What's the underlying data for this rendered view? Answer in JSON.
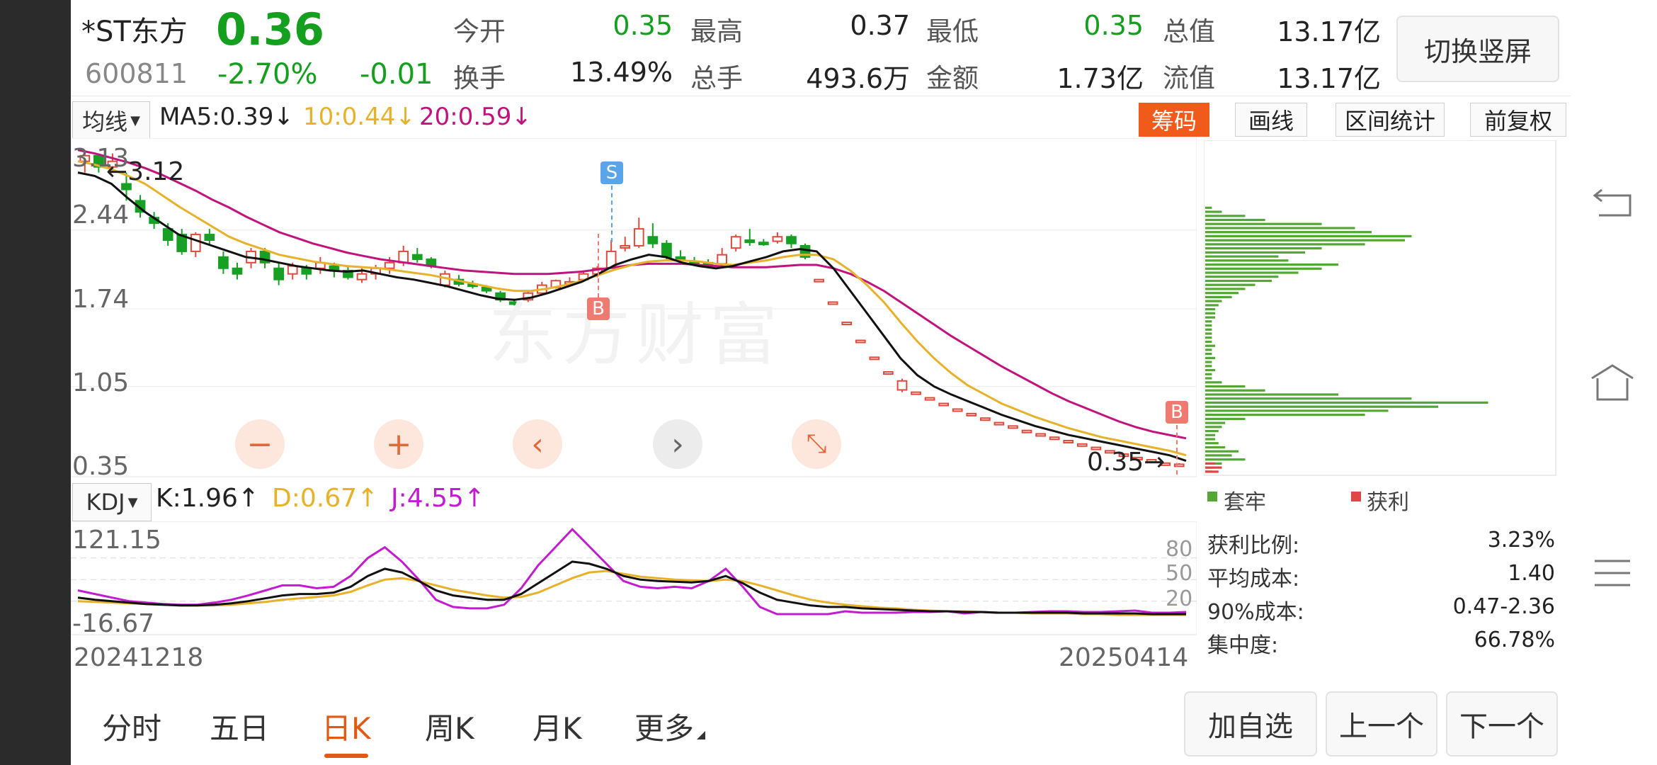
{
  "header": {
    "name": "*ST东方",
    "price": "0.36",
    "code": "600811",
    "pct": "-2.70%",
    "change": "-0.01",
    "fields": [
      {
        "label": "今开",
        "value": "0.35",
        "color": "green"
      },
      {
        "label": "最高",
        "value": "0.37",
        "color": "black"
      },
      {
        "label": "最低",
        "value": "0.35",
        "color": "green"
      },
      {
        "label": "总值",
        "value": "13.17亿",
        "color": "black"
      },
      {
        "label": "换手",
        "value": "13.49%",
        "color": "black"
      },
      {
        "label": "总手",
        "value": "493.6万",
        "color": "black"
      },
      {
        "label": "金额",
        "value": "1.73亿",
        "color": "black"
      },
      {
        "label": "流值",
        "value": "13.17亿",
        "color": "black"
      }
    ],
    "switch_label": "切换竖屏"
  },
  "ma": {
    "selector": "均线",
    "ma5": "MA5:0.39↓",
    "ma10": "10:0.44↓",
    "ma20": "20:0.59↓"
  },
  "tools": {
    "chips": "筹码",
    "draw": "画线",
    "range": "区间统计",
    "adjust": "前复权"
  },
  "price_axis": [
    "3.13",
    "2.44",
    "1.74",
    "1.05",
    "0.35"
  ],
  "annotations": {
    "high": "←3.12",
    "low": "0.35→",
    "sell": "S",
    "buy": "B"
  },
  "watermark": "东方财富",
  "kdj": {
    "selector": "KDJ",
    "k": "K:1.96↑",
    "d": "D:0.67↑",
    "j": "J:4.55↑",
    "axis_top": "121.15",
    "axis_bottom": "-16.67",
    "levels": [
      "80",
      "50",
      "20"
    ]
  },
  "dates": {
    "start": "20241218",
    "end": "20250414"
  },
  "chips": {
    "legend_trap": "套牢",
    "legend_profit": "获利",
    "stats": [
      {
        "label": "获利比例:",
        "value": "3.23%"
      },
      {
        "label": "平均成本:",
        "value": "1.40"
      },
      {
        "label": "90%成本:",
        "value": "0.47-2.36"
      },
      {
        "label": "集中度:",
        "value": "66.78%"
      }
    ]
  },
  "tabs": [
    {
      "label": "分时",
      "active": false
    },
    {
      "label": "五日",
      "active": false
    },
    {
      "label": "日K",
      "active": true
    },
    {
      "label": "周K",
      "active": false
    },
    {
      "label": "月K",
      "active": false
    },
    {
      "label": "更多",
      "active": false
    }
  ],
  "buttons": {
    "add": "加自选",
    "prev": "上一个",
    "next": "下一个"
  },
  "chart_data": {
    "type": "line",
    "ma5": [
      2.95,
      2.92,
      2.85,
      2.72,
      2.6,
      2.5,
      2.4,
      2.35,
      2.3,
      2.25,
      2.2,
      2.18,
      2.15,
      2.12,
      2.1,
      2.08,
      2.07,
      2.08,
      2.05,
      2.02,
      2.0,
      1.97,
      1.94,
      1.9,
      1.86,
      1.83,
      1.82,
      1.84,
      1.88,
      1.93,
      1.98,
      2.05,
      2.13,
      2.18,
      2.22,
      2.2,
      2.15,
      2.12,
      2.1,
      2.12,
      2.16,
      2.2,
      2.25,
      2.27,
      2.25,
      2.1,
      1.9,
      1.7,
      1.5,
      1.3,
      1.15,
      1.05,
      0.98,
      0.92,
      0.86,
      0.8,
      0.75,
      0.7,
      0.66,
      0.62,
      0.59,
      0.56,
      0.53,
      0.5,
      0.47,
      0.44,
      0.39
    ],
    "ma10": [
      3.05,
      3.02,
      2.98,
      2.92,
      2.85,
      2.75,
      2.65,
      2.56,
      2.47,
      2.38,
      2.32,
      2.27,
      2.22,
      2.19,
      2.16,
      2.14,
      2.12,
      2.11,
      2.1,
      2.08,
      2.06,
      2.04,
      2.01,
      1.98,
      1.95,
      1.92,
      1.9,
      1.9,
      1.92,
      1.95,
      1.99,
      2.04,
      2.09,
      2.13,
      2.16,
      2.17,
      2.17,
      2.16,
      2.14,
      2.13,
      2.15,
      2.17,
      2.2,
      2.22,
      2.22,
      2.18,
      2.08,
      1.95,
      1.8,
      1.62,
      1.45,
      1.3,
      1.17,
      1.06,
      0.98,
      0.9,
      0.84,
      0.78,
      0.73,
      0.68,
      0.64,
      0.6,
      0.57,
      0.54,
      0.51,
      0.48,
      0.44
    ],
    "ma20": [
      3.15,
      3.12,
      3.08,
      3.04,
      2.99,
      2.93,
      2.86,
      2.79,
      2.71,
      2.64,
      2.56,
      2.49,
      2.42,
      2.37,
      2.32,
      2.28,
      2.24,
      2.21,
      2.18,
      2.16,
      2.14,
      2.12,
      2.1,
      2.08,
      2.07,
      2.06,
      2.05,
      2.05,
      2.05,
      2.06,
      2.07,
      2.09,
      2.11,
      2.13,
      2.14,
      2.14,
      2.14,
      2.13,
      2.12,
      2.11,
      2.11,
      2.11,
      2.12,
      2.13,
      2.13,
      2.1,
      2.05,
      1.98,
      1.9,
      1.8,
      1.7,
      1.6,
      1.5,
      1.41,
      1.32,
      1.23,
      1.15,
      1.07,
      0.99,
      0.92,
      0.86,
      0.8,
      0.74,
      0.69,
      0.65,
      0.62,
      0.59
    ],
    "candles": [
      [
        3.05,
        3.1,
        3.15,
        2.95
      ],
      [
        3.1,
        3.0,
        3.12,
        2.95
      ],
      [
        3.0,
        3.05,
        3.12,
        2.95
      ],
      [
        2.85,
        2.8,
        2.95,
        2.7
      ],
      [
        2.7,
        2.6,
        2.75,
        2.55
      ],
      [
        2.55,
        2.5,
        2.6,
        2.45
      ],
      [
        2.45,
        2.35,
        2.5,
        2.3
      ],
      [
        2.4,
        2.25,
        2.45,
        2.22
      ],
      [
        2.25,
        2.4,
        2.42,
        2.2
      ],
      [
        2.4,
        2.35,
        2.45,
        2.3
      ],
      [
        2.2,
        2.1,
        2.25,
        2.05
      ],
      [
        2.1,
        2.05,
        2.15,
        2.0
      ],
      [
        2.15,
        2.25,
        2.28,
        2.1
      ],
      [
        2.25,
        2.15,
        2.28,
        2.1
      ],
      [
        2.1,
        2.0,
        2.15,
        1.95
      ],
      [
        2.05,
        2.12,
        2.15,
        2.0
      ],
      [
        2.1,
        2.05,
        2.13,
        2.0
      ],
      [
        2.1,
        2.15,
        2.2,
        2.05
      ],
      [
        2.12,
        2.08,
        2.15,
        2.02
      ],
      [
        2.08,
        2.02,
        2.12,
        2.0
      ],
      [
        2.0,
        2.05,
        2.1,
        1.97
      ],
      [
        2.05,
        2.1,
        2.13,
        2.0
      ],
      [
        2.1,
        2.15,
        2.2,
        2.05
      ],
      [
        2.15,
        2.25,
        2.3,
        2.12
      ],
      [
        2.22,
        2.18,
        2.28,
        2.15
      ],
      [
        2.18,
        2.12,
        2.2,
        2.1
      ],
      [
        1.95,
        2.05,
        2.08,
        1.93
      ],
      [
        2.0,
        1.96,
        2.04,
        1.94
      ],
      [
        1.96,
        1.94,
        1.99,
        1.92
      ],
      [
        1.93,
        1.9,
        1.95,
        1.88
      ],
      [
        1.88,
        1.82,
        1.9,
        1.8
      ],
      [
        1.8,
        1.79,
        1.83,
        1.77
      ],
      [
        1.82,
        1.88,
        1.9,
        1.8
      ],
      [
        1.88,
        1.95,
        1.98,
        1.86
      ],
      [
        1.93,
        1.99,
        2.0,
        1.92
      ],
      [
        1.98,
        1.98,
        2.02,
        1.95
      ],
      [
        2.0,
        2.05,
        2.08,
        1.98
      ],
      [
        2.05,
        2.1,
        2.12,
        2.02
      ],
      [
        2.1,
        2.25,
        2.35,
        2.1
      ],
      [
        2.3,
        2.3,
        2.38,
        2.25
      ],
      [
        2.3,
        2.45,
        2.55,
        2.28
      ],
      [
        2.38,
        2.32,
        2.5,
        2.28
      ],
      [
        2.32,
        2.2,
        2.35,
        2.18
      ],
      [
        2.2,
        2.18,
        2.26,
        2.15
      ],
      [
        2.16,
        2.15,
        2.2,
        2.12
      ],
      [
        2.15,
        2.14,
        2.18,
        2.1
      ],
      [
        2.14,
        2.22,
        2.28,
        2.12
      ],
      [
        2.28,
        2.38,
        2.4,
        2.25
      ],
      [
        2.35,
        2.33,
        2.45,
        2.3
      ],
      [
        2.33,
        2.32,
        2.36,
        2.3
      ],
      [
        2.34,
        2.38,
        2.42,
        2.32
      ],
      [
        2.38,
        2.32,
        2.4,
        2.28
      ],
      [
        2.3,
        2.2,
        2.32,
        2.18
      ],
      [
        2.0,
        2.0,
        2.0,
        2.0
      ],
      [
        1.8,
        1.8,
        1.8,
        1.8
      ],
      [
        1.62,
        1.62,
        1.62,
        1.62
      ],
      [
        1.46,
        1.46,
        1.46,
        1.46
      ],
      [
        1.31,
        1.31,
        1.31,
        1.31
      ],
      [
        1.18,
        1.18,
        1.18,
        1.18
      ],
      [
        1.02,
        1.1,
        1.12,
        1.0
      ],
      [
        1.0,
        1.0,
        1.0,
        1.0
      ],
      [
        0.95,
        0.95,
        0.95,
        0.95
      ],
      [
        0.9,
        0.9,
        0.9,
        0.9
      ],
      [
        0.85,
        0.85,
        0.85,
        0.85
      ],
      [
        0.81,
        0.81,
        0.81,
        0.81
      ],
      [
        0.77,
        0.77,
        0.77,
        0.77
      ],
      [
        0.73,
        0.73,
        0.73,
        0.73
      ],
      [
        0.7,
        0.7,
        0.7,
        0.7
      ],
      [
        0.66,
        0.66,
        0.66,
        0.66
      ],
      [
        0.63,
        0.63,
        0.63,
        0.63
      ],
      [
        0.6,
        0.6,
        0.6,
        0.6
      ],
      [
        0.57,
        0.57,
        0.57,
        0.57
      ],
      [
        0.54,
        0.54,
        0.54,
        0.54
      ],
      [
        0.51,
        0.51,
        0.51,
        0.51
      ],
      [
        0.48,
        0.48,
        0.48,
        0.48
      ],
      [
        0.45,
        0.45,
        0.45,
        0.45
      ],
      [
        0.42,
        0.42,
        0.42,
        0.42
      ],
      [
        0.4,
        0.4,
        0.4,
        0.4
      ],
      [
        0.37,
        0.37,
        0.37,
        0.37
      ],
      [
        0.36,
        0.36,
        0.37,
        0.35
      ]
    ],
    "kdj_k": [
      25,
      22,
      20,
      18,
      16,
      15,
      14,
      14,
      15,
      17,
      20,
      24,
      28,
      30,
      30,
      32,
      40,
      55,
      65,
      60,
      48,
      35,
      28,
      25,
      22,
      22,
      30,
      45,
      60,
      75,
      72,
      65,
      55,
      50,
      48,
      47,
      46,
      48,
      55,
      45,
      32,
      22,
      18,
      14,
      12,
      12,
      10,
      9,
      8,
      7,
      6,
      6,
      5,
      5,
      4,
      4,
      4,
      4,
      4,
      3,
      3,
      3,
      3,
      2,
      2,
      2
    ],
    "kdj_d": [
      20,
      19,
      18,
      17,
      16,
      15,
      14,
      14,
      14,
      15,
      17,
      19,
      22,
      24,
      26,
      28,
      33,
      42,
      50,
      52,
      48,
      42,
      36,
      32,
      28,
      25,
      26,
      32,
      42,
      52,
      60,
      62,
      58,
      54,
      52,
      50,
      49,
      48,
      50,
      48,
      42,
      35,
      28,
      22,
      18,
      15,
      13,
      11,
      10,
      8,
      7,
      6,
      6,
      5,
      4,
      4,
      3,
      3,
      3,
      2,
      2,
      1,
      1,
      1,
      1,
      1
    ],
    "kdj_j": [
      35,
      30,
      25,
      20,
      18,
      16,
      15,
      15,
      18,
      22,
      28,
      35,
      42,
      42,
      38,
      40,
      55,
      80,
      95,
      75,
      50,
      22,
      12,
      10,
      10,
      15,
      38,
      70,
      95,
      120,
      96,
      72,
      48,
      40,
      38,
      40,
      38,
      48,
      65,
      40,
      12,
      2,
      2,
      2,
      2,
      6,
      4,
      4,
      4,
      5,
      5,
      6,
      3,
      5,
      4,
      4,
      5,
      6,
      6,
      5,
      5,
      6,
      7,
      4,
      4,
      5
    ],
    "chip_trap": [
      0,
      0,
      0,
      0,
      0,
      0,
      0,
      0,
      0,
      0,
      0,
      0,
      0,
      0,
      0,
      0,
      2,
      5,
      12,
      18,
      35,
      45,
      50,
      62,
      60,
      48,
      35,
      30,
      22,
      25,
      40,
      35,
      28,
      22,
      20,
      15,
      12,
      10,
      8,
      5,
      4,
      3,
      3,
      3,
      2,
      2,
      2,
      2,
      2,
      2,
      3,
      2,
      2,
      3,
      2,
      2,
      3,
      2,
      2,
      5,
      12,
      18,
      40,
      62,
      85,
      70,
      55,
      48,
      12,
      6,
      5,
      4,
      3,
      3,
      4,
      6,
      10,
      8,
      12,
      5,
      3,
      2
    ],
    "chip_profit": [
      0,
      0,
      0,
      0,
      0,
      0,
      0,
      0,
      0,
      0,
      0,
      0,
      0,
      0,
      0,
      0,
      0,
      0,
      0,
      0,
      0,
      0,
      0,
      0,
      0,
      0,
      0,
      0,
      0,
      0,
      0,
      0,
      0,
      0,
      0,
      0,
      0,
      0,
      0,
      0,
      0,
      0,
      0,
      0,
      0,
      0,
      0,
      0,
      0,
      0,
      0,
      0,
      0,
      0,
      0,
      0,
      0,
      0,
      0,
      0,
      0,
      0,
      0,
      0,
      0,
      0,
      0,
      0,
      0,
      0,
      0,
      0,
      0,
      0,
      0,
      0,
      0,
      0,
      0,
      3,
      5,
      4
    ],
    "ylim": [
      0.35,
      3.13
    ],
    "kdj_ylim": [
      -16.67,
      121.15
    ]
  }
}
